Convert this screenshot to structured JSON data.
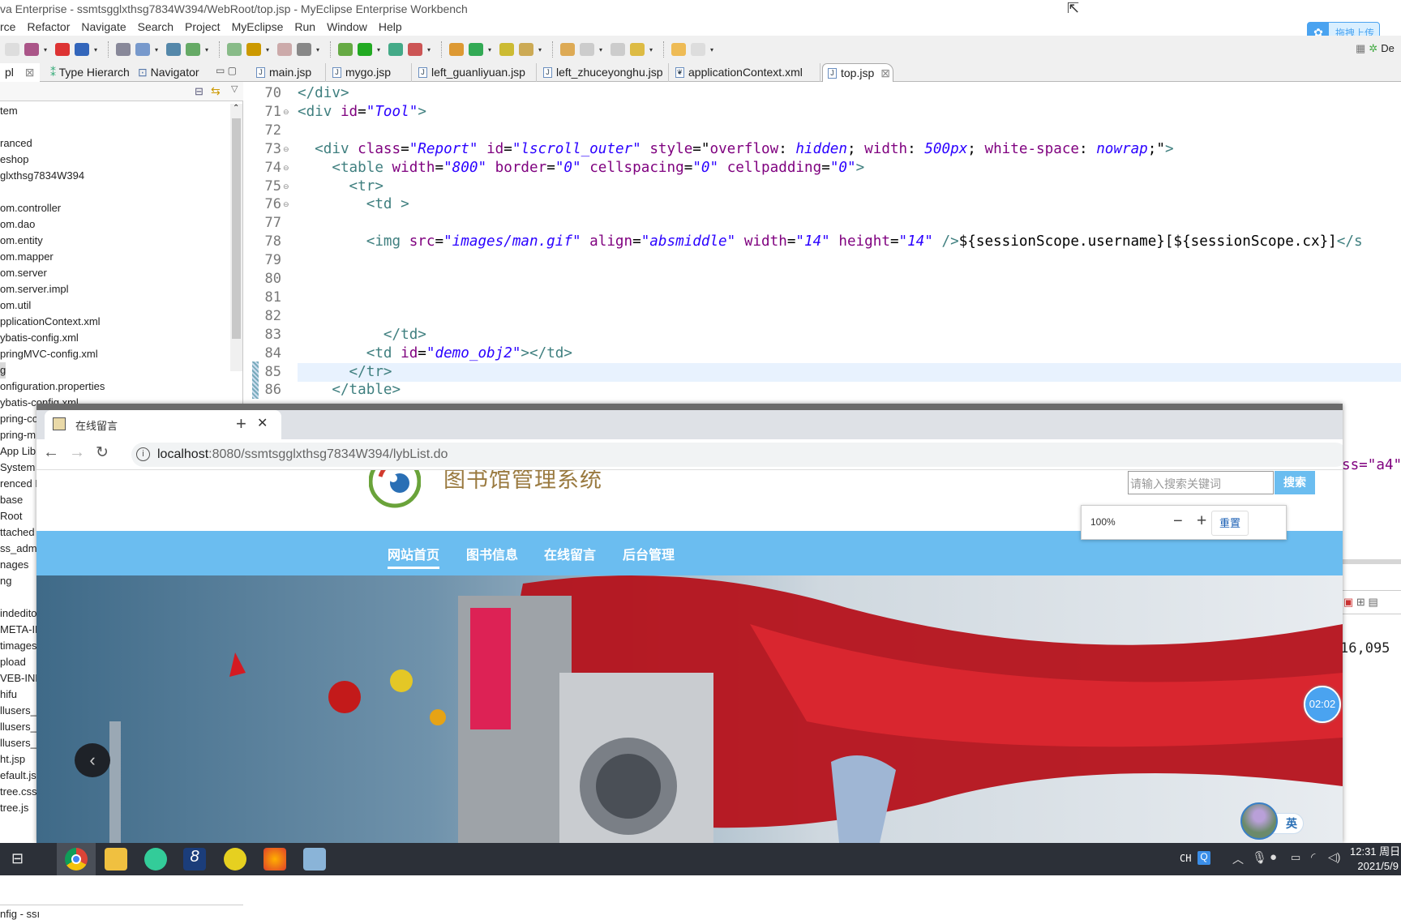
{
  "window": {
    "title": "va Enterprise - ssmtsgglxthsg7834W394/WebRoot/top.jsp - MyEclipse Enterprise Workbench"
  },
  "menu": [
    "rce",
    "Refactor",
    "Navigate",
    "Search",
    "Project",
    "MyEclipse",
    "Run",
    "Window",
    "Help"
  ],
  "baidu_upload": {
    "label": "拖拽上传",
    "color": "#4aa3f0"
  },
  "perspective": {
    "label": "De"
  },
  "left_tabs": [
    {
      "label": "pl"
    },
    {
      "label": "Type Hierarch"
    },
    {
      "label": "Navigator"
    }
  ],
  "editor_tabs": [
    {
      "label": "main.jsp"
    },
    {
      "label": "mygo.jsp"
    },
    {
      "label": "left_guanliyuan.jsp"
    },
    {
      "label": "left_zhuceyonghu.jsp"
    },
    {
      "label": "applicationContext.xml"
    },
    {
      "label": "top.jsp",
      "active": true
    }
  ],
  "tree": [
    "tem",
    "",
    "ranced",
    "eshop",
    "glxthsg7834W394",
    "",
    "om.controller",
    "om.dao",
    "om.entity",
    "om.mapper",
    "om.server",
    "om.server.impl",
    "om.util",
    "pplicationContext.xml",
    "ybatis-config.xml",
    "pringMVC-config.xml",
    "g",
    "onfiguration.properties",
    "ybatis-config.xml",
    "pring-co",
    "pring-m",
    " App Lib",
    "System L",
    "renced L",
    "base",
    "Root",
    "ttached",
    "ss_admi",
    "nages",
    "ng",
    "",
    "indedito",
    "META-IN",
    "timages",
    "pload",
    "VEB-INF",
    "hifu",
    "llusers_a",
    "llusers_l",
    "llusers_u",
    "ht.jsp",
    "efault.js",
    "tree.css",
    "tree.js"
  ],
  "tree_selected": 16,
  "status_left": "nfig - ssı",
  "code": [
    {
      "n": "70",
      "fold": false,
      "t": [
        [
          "tag",
          "</div>"
        ]
      ]
    },
    {
      "n": "71",
      "fold": true,
      "t": [
        [
          "tag",
          "<div "
        ],
        [
          "attr",
          "id"
        ],
        [
          "txt",
          "="
        ],
        [
          "val",
          "\"Tool\""
        ],
        [
          "tag",
          ">"
        ]
      ]
    },
    {
      "n": "72",
      "fold": false,
      "t": []
    },
    {
      "n": "73",
      "fold": true,
      "t": [
        [
          "tag",
          "  <div "
        ],
        [
          "attr",
          "class"
        ],
        [
          "txt",
          "="
        ],
        [
          "val",
          "\"Report\""
        ],
        [
          "txt",
          " "
        ],
        [
          "attr",
          "id"
        ],
        [
          "txt",
          "="
        ],
        [
          "val",
          "\"lscroll_outer\""
        ],
        [
          "txt",
          " "
        ],
        [
          "attr",
          "style"
        ],
        [
          "txt",
          "=\""
        ],
        [
          "attr",
          "overflow"
        ],
        [
          "txt",
          ": "
        ],
        [
          "val",
          "hidden"
        ],
        [
          "txt",
          "; "
        ],
        [
          "attr",
          "width"
        ],
        [
          "txt",
          ": "
        ],
        [
          "val",
          "500px"
        ],
        [
          "txt",
          "; "
        ],
        [
          "attr",
          "white-space"
        ],
        [
          "txt",
          ": "
        ],
        [
          "val",
          "nowrap"
        ],
        [
          "txt",
          ";\""
        ],
        [
          "tag",
          ">"
        ]
      ]
    },
    {
      "n": "74",
      "fold": true,
      "t": [
        [
          "tag",
          "    <table "
        ],
        [
          "attr",
          "width"
        ],
        [
          "txt",
          "="
        ],
        [
          "val",
          "\"800\""
        ],
        [
          "txt",
          " "
        ],
        [
          "attr",
          "border"
        ],
        [
          "txt",
          "="
        ],
        [
          "val",
          "\"0\""
        ],
        [
          "txt",
          " "
        ],
        [
          "attr",
          "cellspacing"
        ],
        [
          "txt",
          "="
        ],
        [
          "val",
          "\"0\""
        ],
        [
          "txt",
          " "
        ],
        [
          "attr",
          "cellpadding"
        ],
        [
          "txt",
          "="
        ],
        [
          "val",
          "\"0\""
        ],
        [
          "tag",
          ">"
        ]
      ]
    },
    {
      "n": "75",
      "fold": true,
      "t": [
        [
          "tag",
          "      <tr>"
        ]
      ]
    },
    {
      "n": "76",
      "fold": true,
      "t": [
        [
          "tag",
          "        <td >"
        ]
      ]
    },
    {
      "n": "77",
      "fold": false,
      "t": []
    },
    {
      "n": "78",
      "fold": false,
      "t": [
        [
          "tag",
          "        <img "
        ],
        [
          "attr",
          "src"
        ],
        [
          "txt",
          "="
        ],
        [
          "val",
          "\"images/man.gif\""
        ],
        [
          "txt",
          " "
        ],
        [
          "attr",
          "align"
        ],
        [
          "txt",
          "="
        ],
        [
          "val",
          "\"absmiddle\""
        ],
        [
          "txt",
          " "
        ],
        [
          "attr",
          "width"
        ],
        [
          "txt",
          "="
        ],
        [
          "val",
          "\"14\""
        ],
        [
          "txt",
          " "
        ],
        [
          "attr",
          "height"
        ],
        [
          "txt",
          "="
        ],
        [
          "val",
          "\"14\""
        ],
        [
          "tag",
          " />"
        ],
        [
          "txt",
          "${sessionScope.username}[${sessionScope.cx}]"
        ],
        [
          "tag",
          "</s"
        ]
      ]
    },
    {
      "n": "79",
      "fold": false,
      "t": []
    },
    {
      "n": "80",
      "fold": false,
      "t": []
    },
    {
      "n": "81",
      "fold": false,
      "t": []
    },
    {
      "n": "82",
      "fold": false,
      "t": []
    },
    {
      "n": "83",
      "fold": false,
      "t": [
        [
          "tag",
          "          </td>"
        ]
      ]
    },
    {
      "n": "84",
      "fold": false,
      "t": [
        [
          "tag",
          "        <td "
        ],
        [
          "attr",
          "id"
        ],
        [
          "txt",
          "="
        ],
        [
          "val",
          "\"demo_obj2\""
        ],
        [
          "tag",
          "></td>"
        ]
      ]
    },
    {
      "n": "85",
      "fold": false,
      "t": [
        [
          "tag",
          "      </tr>"
        ]
      ]
    },
    {
      "n": "86",
      "fold": false,
      "t": [
        [
          "tag",
          "    </table>"
        ]
      ]
    }
  ],
  "current_line": "85",
  "code_right_fragment": "ss=\"a4\"",
  "console_fragment": "16,095",
  "browser": {
    "tab_title": "在线留言",
    "new_tab": "+",
    "url_host": "localhost",
    "url_rest": ":8080/ssmtsgglxthsg7834W394/lybList.do",
    "site_title": "图书馆管理系统",
    "search_placeholder": "请输入搜索关键词",
    "search_button": "搜索",
    "zoom": {
      "level": "100%",
      "minus": "−",
      "plus": "+",
      "reset": "重置"
    },
    "nav": [
      {
        "label": "网站首页",
        "active": true
      },
      {
        "label": "图书信息"
      },
      {
        "label": "在线留言"
      },
      {
        "label": "后台管理"
      }
    ],
    "nav_color": "#6bbdf0"
  },
  "timer": "02:02",
  "ime_badge": "英",
  "tray": {
    "lang": "CH",
    "time": "12:31 周日",
    "date": "2021/5/9"
  }
}
